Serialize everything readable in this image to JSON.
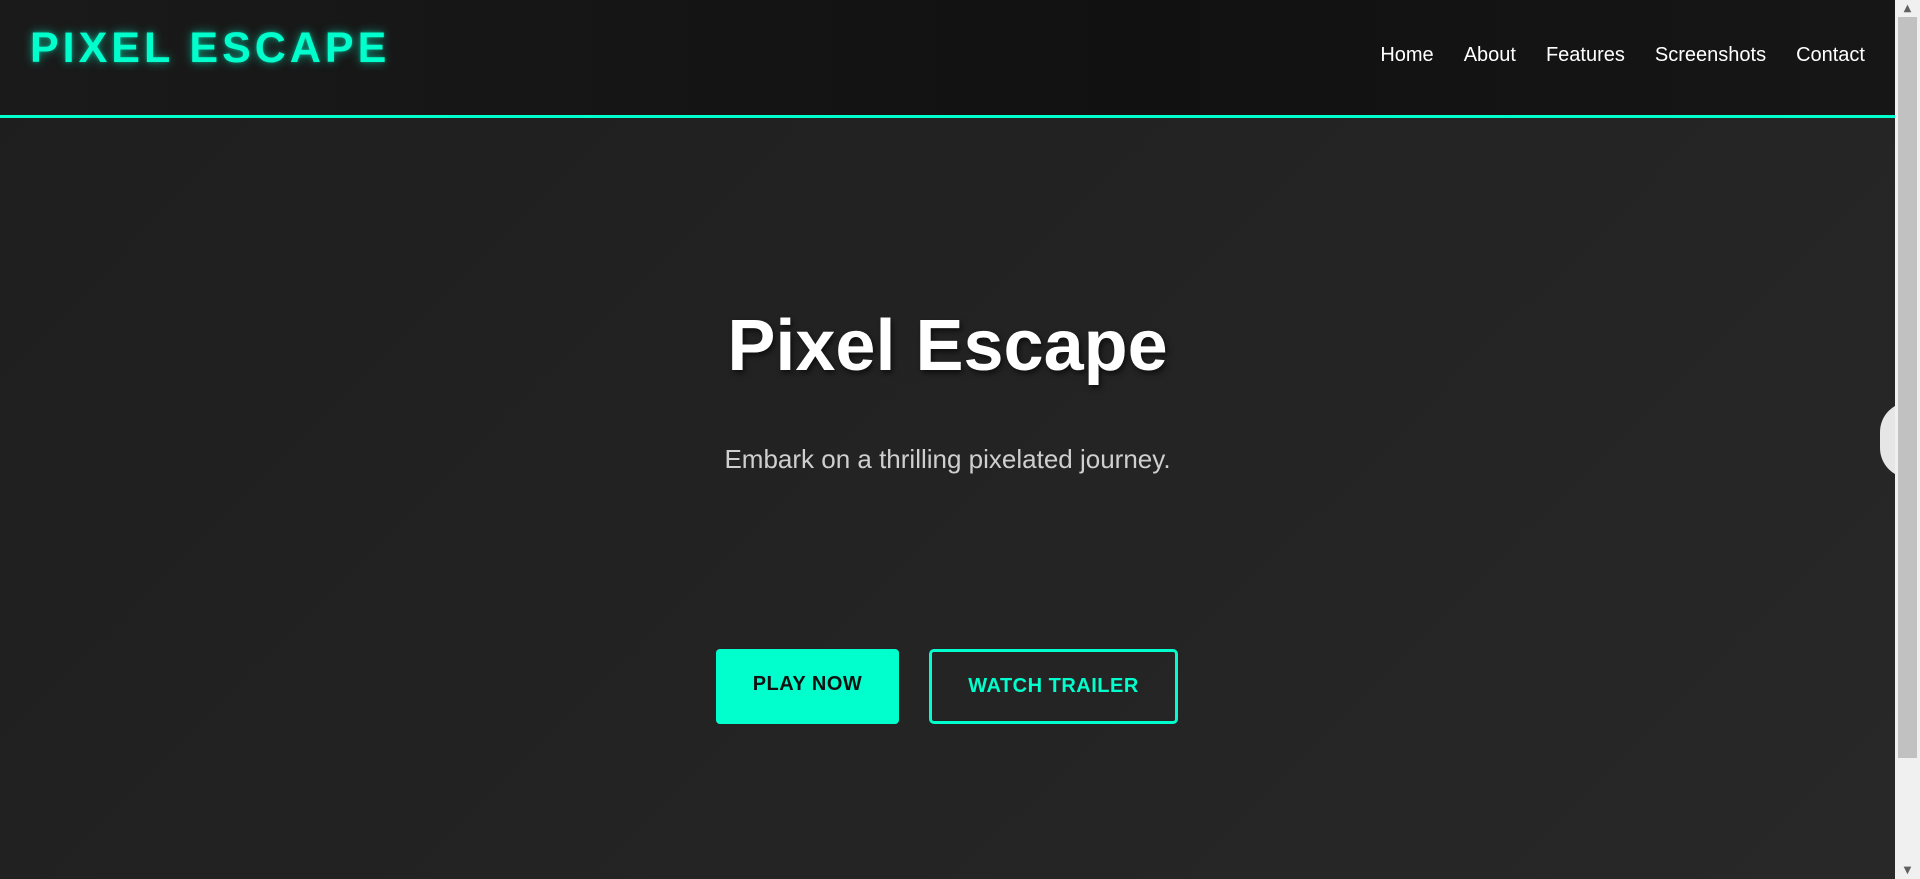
{
  "header": {
    "logo": "PIXEL ESCAPE",
    "nav": [
      "Home",
      "About",
      "Features",
      "Screenshots",
      "Contact"
    ]
  },
  "hero": {
    "title": "Pixel Escape",
    "subtitle": "Embark on a thrilling pixelated journey.",
    "primary_button": "PLAY NOW",
    "secondary_button": "WATCH TRAILER"
  },
  "colors": {
    "accent": "#00ffcc",
    "background": "#232323",
    "header_bg": "#111111",
    "text": "#ffffff"
  },
  "icons": {
    "scroll_up": "scroll-up-arrow-icon",
    "scroll_down": "scroll-down-arrow-icon"
  }
}
